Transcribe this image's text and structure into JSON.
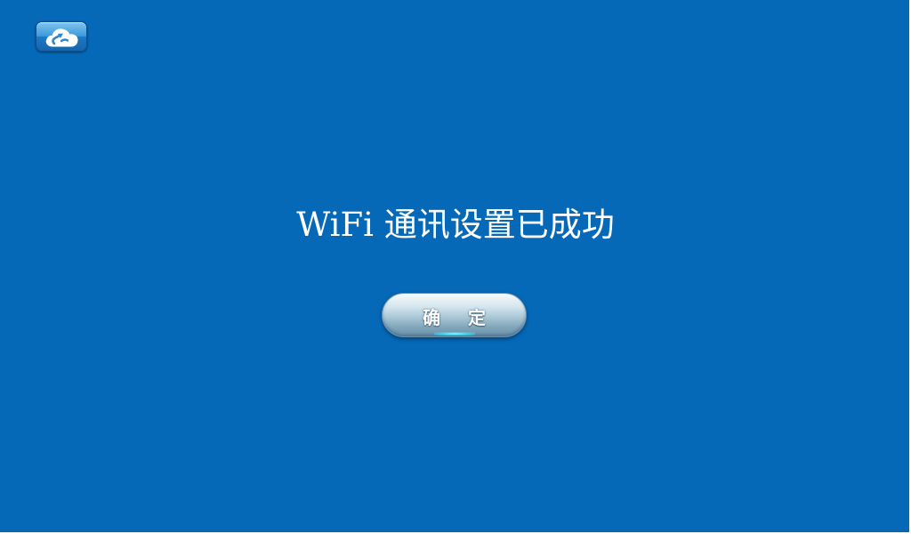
{
  "app": {
    "cloud_icon": "cloud-link-icon"
  },
  "dialog": {
    "message": "WiFi 通讯设置已成功",
    "confirm_label": "确 定"
  },
  "colors": {
    "background": "#0569b8",
    "text": "#ffffff",
    "button_light": "#f6fbfd",
    "button_dark": "#6d93aa",
    "button_glow": "#3fd2ef"
  }
}
